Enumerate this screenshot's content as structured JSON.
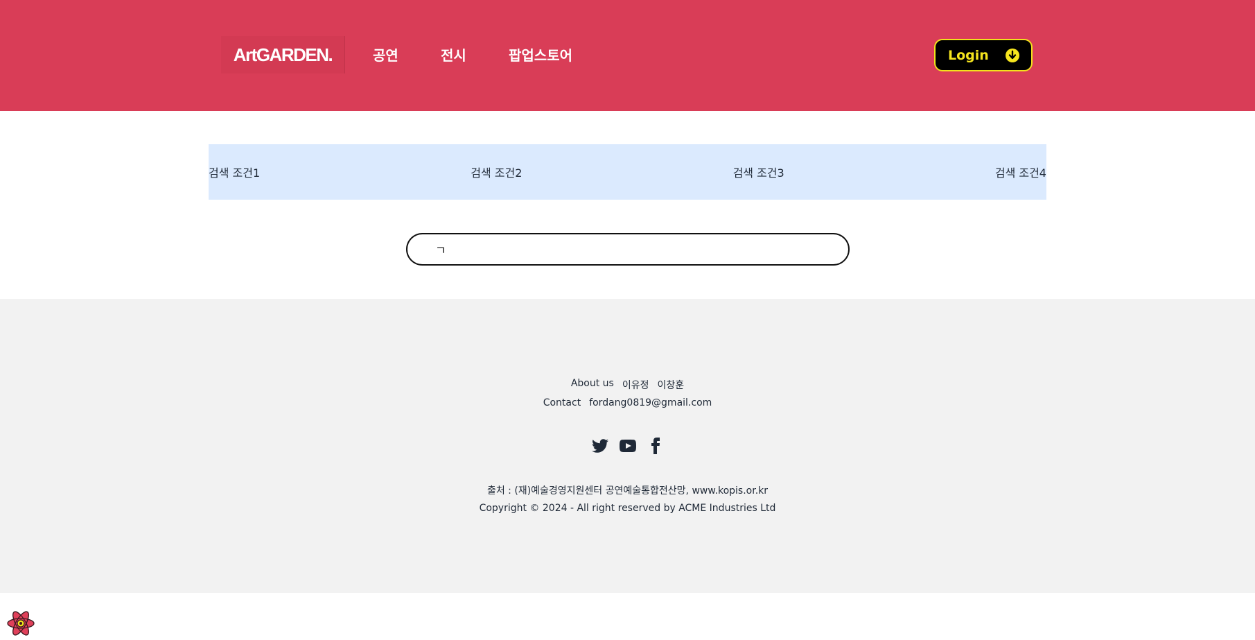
{
  "header": {
    "logo": "ArtGARDEN.",
    "nav": [
      "공연",
      "전시",
      "팝업스토어"
    ],
    "login_label": "Login",
    "login_icon": "arrow-down-circle-icon",
    "background_color": "#d93d57",
    "accent_color": "#f6e51e"
  },
  "filters": [
    "검색 조건1",
    "검색 조건2",
    "검색 조건3",
    "검색 조건4"
  ],
  "search": {
    "value": "ㄱ",
    "placeholder": ""
  },
  "footer": {
    "about_label": "About us",
    "members": [
      "이유정",
      "이창훈"
    ],
    "contact_label": "Contact",
    "contact_email": "fordang0819@gmail.com",
    "social_icons": [
      "twitter-icon",
      "youtube-icon",
      "facebook-icon"
    ],
    "source": "출처 : (재)예술경영지원센터 공연예술통합전산망, www.kopis.or.kr",
    "copyright": "Copyright © 2024 - All right reserved by ACME Industries Ltd"
  },
  "dev_badge_icon": "react-logo-icon"
}
